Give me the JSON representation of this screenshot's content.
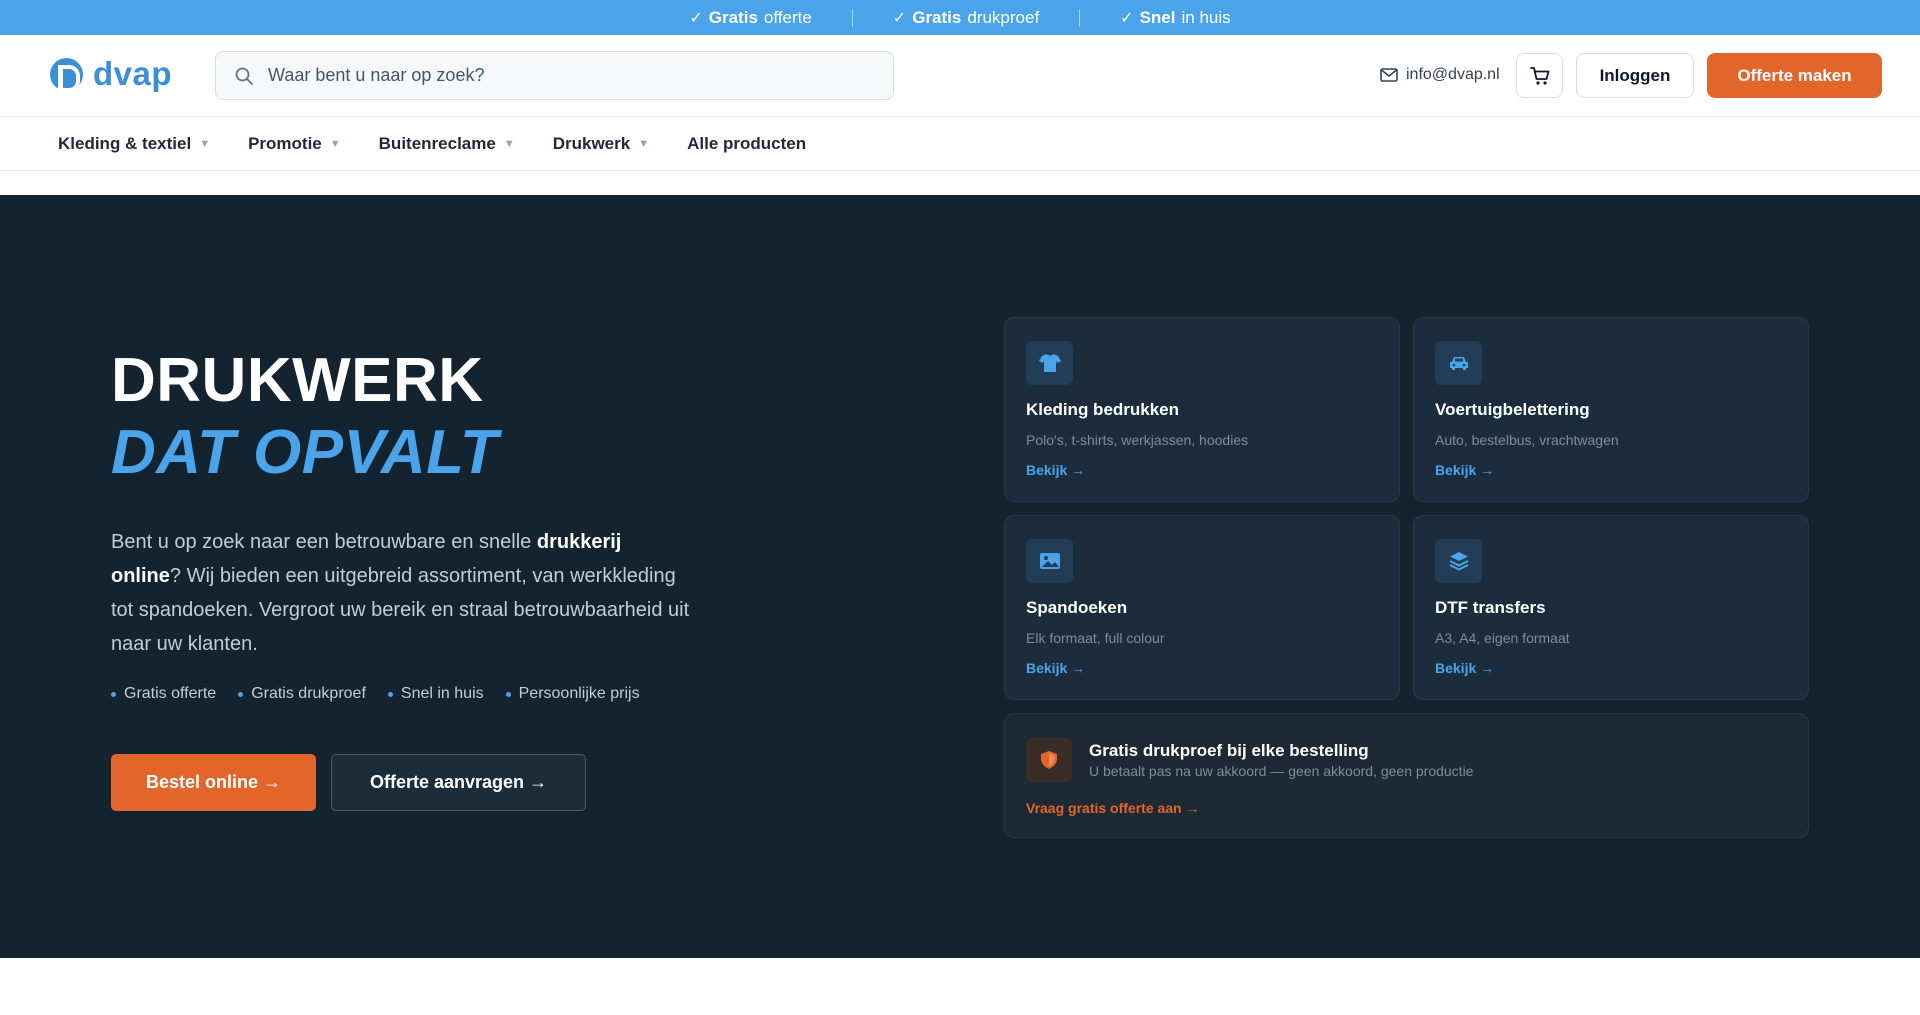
{
  "topbar": {
    "usps": [
      {
        "bold": "Gratis",
        "text": "offerte"
      },
      {
        "bold": "Gratis",
        "text": "drukproef"
      },
      {
        "bold": "Snel",
        "text": "in huis"
      }
    ]
  },
  "header": {
    "logo_text": "dvap",
    "search_placeholder": "Waar bent u naar op zoek?",
    "email": "info@dvap.nl",
    "login_label": "Inloggen",
    "offer_label": "Offerte maken"
  },
  "nav": {
    "items": [
      {
        "label": "Kleding & textiel"
      },
      {
        "label": "Promotie"
      },
      {
        "label": "Buitenreclame"
      },
      {
        "label": "Drukwerk"
      },
      {
        "label": "Alle producten"
      }
    ]
  },
  "hero": {
    "title_line1": "DRUKWERK",
    "title_line2": "DAT OPVALT",
    "desc_part1": "Bent u op zoek naar een betrouwbare en snelle ",
    "desc_bold": "drukkerij online",
    "desc_part2": "? Wij bieden een uitgebreid assortiment, van werkkleding tot spandoeken. Vergroot uw bereik en straal betrouwbaarheid uit naar uw klanten.",
    "bullets": [
      "Gratis offerte",
      "Gratis drukproef",
      "Snel in huis",
      "Persoonlijke prijs"
    ],
    "btn_primary": "Bestel online →",
    "btn_secondary": "Offerte aanvragen →"
  },
  "cards": [
    {
      "icon": "tshirt-icon",
      "title": "Kleding bedrukken",
      "subtitle": "Polo's, t-shirts, werkjassen, hoodies",
      "link": "Bekijk →"
    },
    {
      "icon": "car-icon",
      "title": "Voertuigbelettering",
      "subtitle": "Auto, bestelbus, vrachtwagen",
      "link": "Bekijk →"
    },
    {
      "icon": "image-icon",
      "title": "Spandoeken",
      "subtitle": "Elk formaat, full colour",
      "link": "Bekijk →"
    },
    {
      "icon": "layers-icon",
      "title": "DTF transfers",
      "subtitle": "A3, A4, eigen formaat",
      "link": "Bekijk →"
    }
  ],
  "promo": {
    "icon": "shield-icon",
    "title": "Gratis drukproef bij elke bestelling",
    "subtitle": "U betaalt pas na uw akkoord — geen akkoord, geen productie",
    "link": "Vraag gratis offerte aan →"
  },
  "colors": {
    "accent_blue": "#4ba3ea",
    "accent_orange": "#e2652b",
    "hero_bg": "#132330"
  }
}
